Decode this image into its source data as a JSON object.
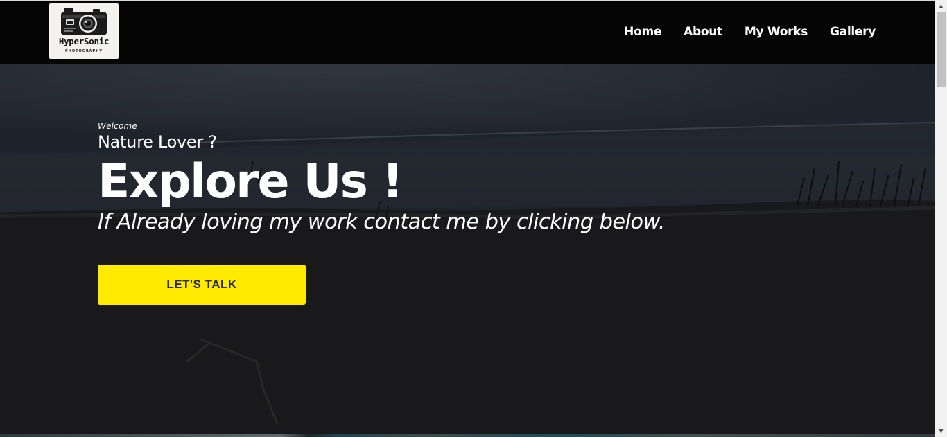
{
  "brand": {
    "logo_text": "HyperSonic",
    "logo_subtext": "PHOTOGRAPHY"
  },
  "nav": {
    "items": [
      {
        "label": "Home"
      },
      {
        "label": "About"
      },
      {
        "label": "My Works"
      },
      {
        "label": "Gallery"
      }
    ]
  },
  "hero": {
    "welcome": "Welcome",
    "tagline": "Nature Lover ?",
    "headline": "Explore Us !",
    "subline": "If Already loving my work contact me by clicking below.",
    "cta_label": "LET'S TALK"
  },
  "colors": {
    "navbar_bg": "#050505",
    "cta_bg": "#ffea00",
    "text": "#ffffff"
  },
  "icons": {
    "logo": "camera-icon",
    "scroll_up": "scroll-up-arrow-icon",
    "scroll_down": "scroll-down-arrow-icon"
  }
}
